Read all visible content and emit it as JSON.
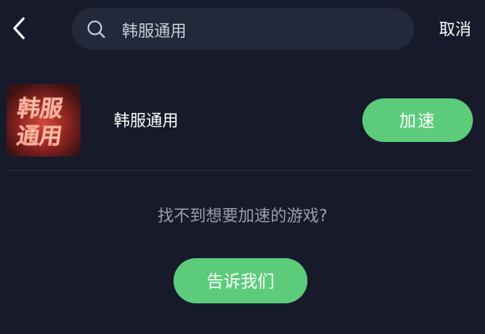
{
  "header": {
    "back_icon": "chevron-left-icon",
    "search": {
      "icon": "search-icon",
      "value": "韩服通用",
      "placeholder": ""
    },
    "cancel_label": "取消"
  },
  "result": {
    "icon_text_line1": "韩服",
    "icon_text_line2": "通用",
    "name": "韩服通用",
    "action_label": "加速"
  },
  "footer": {
    "prompt": "找不到想要加速的游戏?",
    "feedback_label": "告诉我们"
  },
  "colors": {
    "background": "#161a2b",
    "search_bg": "#23283a",
    "accent_green": "#5ccc7b",
    "muted_text": "#9a9faf"
  }
}
